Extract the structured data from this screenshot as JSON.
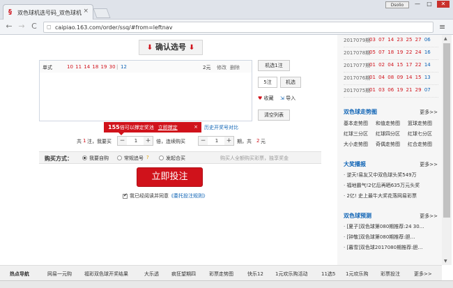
{
  "browser": {
    "tab_title": "双色球机选号码_双色球机",
    "tab_close": "×",
    "user_badge": "Dsolio",
    "url": "caipiao.163.com/order/ssq/#from=leftnav",
    "back": "←",
    "forward": "→",
    "reload": "C",
    "menu": "≡",
    "win_min": "—",
    "win_max": "□",
    "win_close": "✕"
  },
  "main": {
    "confirm_button": "确认选号",
    "confirm_arrow": "⬇",
    "ticket": {
      "type": "单式",
      "red_balls": "10 11 14 18 19 30",
      "separator": "|",
      "blue_ball": "12",
      "price": "2元",
      "edit": "修改",
      "delete": "删除"
    },
    "side_buttons": {
      "random_one": "机选1注",
      "count_value": "5注",
      "random": "机选",
      "favorite": "收藏",
      "import": "导入",
      "clear": "清空列表"
    },
    "tooltip": {
      "count": "155",
      "text": "倍可以撑定奖池",
      "link": "立即撑定",
      "close": "×"
    },
    "compare_link": "历史开奖号对比",
    "bet": {
      "prefix": "共",
      "notes": "1",
      "notes_label": "注，我要买",
      "multiple": "1",
      "multiple_label": "倍，连续购买",
      "periods": "1",
      "periods_label": "期，共",
      "total": "2",
      "currency": "元"
    },
    "buy_method": {
      "label": "购买方式：",
      "options": [
        "我要自购",
        "常规追号",
        "发起合买"
      ],
      "selected": "我要自购",
      "note": "购买人全额购买彩票，独享奖金"
    },
    "submit_button": "立即投注",
    "agree": {
      "text": "我已经阅读并同意",
      "link": "《委托投注规则》"
    }
  },
  "sidebar": {
    "draws": [
      {
        "issue": "2017079期",
        "red": "03 07 14 23 25 27",
        "blue": "06"
      },
      {
        "issue": "2017078期",
        "red": "05 07 18 19 22 24",
        "blue": "16"
      },
      {
        "issue": "2017077期",
        "red": "01 02 04 15 17 22",
        "blue": "14"
      },
      {
        "issue": "2017076期",
        "red": "01 04 08 09 14 15",
        "blue": "13"
      },
      {
        "issue": "2017075期",
        "red": "01 03 06 19 21 29",
        "blue": "07"
      }
    ],
    "trend": {
      "title": "双色球走势图",
      "more": "更多>>",
      "links": [
        "基本走势图",
        "和值走势图",
        "篮球走势图",
        "红球三分区",
        "红球四分区",
        "红球七分区",
        "大小走势图",
        "奇偶走势图",
        "红合走势图"
      ]
    },
    "winners": {
      "title": "大奖播报",
      "more": "更多>>",
      "items": [
        "逆天!易友又中双色球头奖549万",
        "福地霸气!2亿后再晒635万元头奖",
        "2亿! 史上最牛大奖花落网易彩票"
      ]
    },
    "forecast": {
      "title": "双色球预测",
      "more": "更多>>",
      "items": [
        "[夏子]双色球第080期推荐:24 30…",
        "[钟敬]双色球第080期推荐:胆…",
        "[暮雪]双色球2017080期推荐:胆…"
      ]
    }
  },
  "bottom_nav": {
    "title": "热点导航",
    "links": [
      "网易一元购",
      "福彩双色球开奖结果",
      "大乐透",
      "疯狂望期四",
      "彩票走势图",
      "快乐12",
      "1元欢乐购活动",
      "11选5",
      "1元欢乐购",
      "彩票投注",
      "更多>>"
    ]
  },
  "colors": {
    "accent_red": "#d0121b",
    "link_blue": "#0e63b5"
  }
}
